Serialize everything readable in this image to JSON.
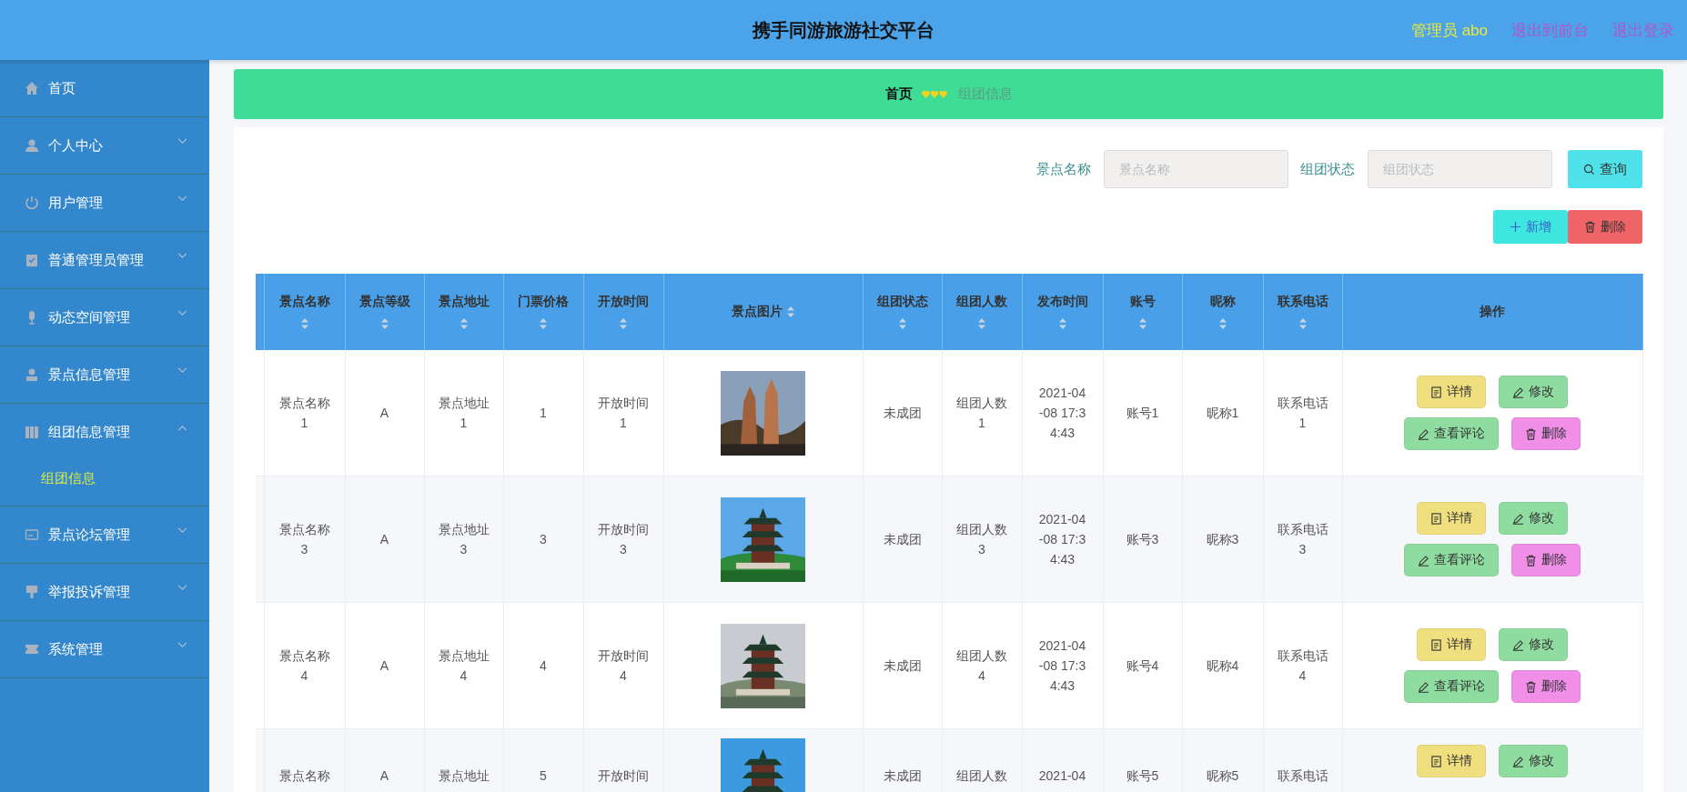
{
  "header": {
    "title": "携手同游旅游社交平台",
    "user": "管理员 abo",
    "links": [
      "退出到前台",
      "退出登录"
    ]
  },
  "sidebar": {
    "items": [
      {
        "label": "首页"
      },
      {
        "label": "个人中心",
        "expanded": false
      },
      {
        "label": "用户管理",
        "expanded": false
      },
      {
        "label": "普通管理员管理",
        "expanded": false
      },
      {
        "label": "动态空间管理",
        "expanded": false
      },
      {
        "label": "景点信息管理",
        "expanded": false
      },
      {
        "label": "组团信息管理",
        "expanded": true,
        "children": [
          {
            "label": "组团信息",
            "selected": true
          }
        ]
      },
      {
        "label": "景点论坛管理",
        "expanded": false
      },
      {
        "label": "举报投诉管理",
        "expanded": false
      },
      {
        "label": "系统管理",
        "expanded": false
      }
    ]
  },
  "breadcrumb": [
    "首页",
    "组团信息"
  ],
  "search": {
    "fields": [
      {
        "label": "景点名称",
        "placeholder": "景点名称"
      },
      {
        "label": "组团状态",
        "placeholder": "组团状态"
      }
    ],
    "button": "查询"
  },
  "actions": [
    {
      "kind": "add",
      "label": "新增"
    },
    {
      "kind": "delete",
      "label": "删除"
    }
  ],
  "table": {
    "columns": [
      {
        "label": "景点名称",
        "sortable": true
      },
      {
        "label": "景点等级",
        "sortable": true
      },
      {
        "label": "景点地址",
        "sortable": true
      },
      {
        "label": "门票价格",
        "sortable": true
      },
      {
        "label": "开放时间",
        "sortable": true
      },
      {
        "label": "景点图片",
        "sortable": true
      },
      {
        "label": "组团状态",
        "sortable": true
      },
      {
        "label": "组团人数",
        "sortable": true
      },
      {
        "label": "发布时间",
        "sortable": true
      },
      {
        "label": "账号",
        "sortable": true
      },
      {
        "label": "昵称",
        "sortable": true
      },
      {
        "label": "联系电话",
        "sortable": true
      },
      {
        "label": "操作",
        "sortable": false
      }
    ],
    "rows": [
      {
        "cells": [
          "景点名称1",
          "A",
          "景点地址1",
          "1",
          "开放时间1",
          null,
          "未成团",
          "组团人数1",
          "2021-04-08 17:34:43",
          "账号1",
          "昵称1",
          "联系电话1"
        ],
        "image": {
          "kind": "picture"
        },
        "buttons": [
          {
            "kind": "detail",
            "label": "详情"
          },
          {
            "kind": "edit",
            "label": "修改"
          },
          {
            "kind": "review",
            "label": "查看评论"
          },
          {
            "kind": "delete",
            "label": "删除"
          }
        ]
      },
      {
        "cells": [
          "景点名称3",
          "A",
          "景点地址3",
          "3",
          "开放时间3",
          null,
          "未成团",
          "组团人数3",
          "2021-04-08 17:34:43",
          "账号3",
          "昵称3",
          "联系电话3"
        ],
        "image": {
          "kind": "picture"
        },
        "buttons": [
          {
            "kind": "detail",
            "label": "详情"
          },
          {
            "kind": "edit",
            "label": "修改"
          },
          {
            "kind": "review",
            "label": "查看评论"
          },
          {
            "kind": "delete",
            "label": "删除"
          }
        ]
      },
      {
        "cells": [
          "景点名称4",
          "A",
          "景点地址4",
          "4",
          "开放时间4",
          null,
          "未成团",
          "组团人数4",
          "2021-04-08 17:34:43",
          "账号4",
          "昵称4",
          "联系电话4"
        ],
        "image": {
          "kind": "picture"
        },
        "buttons": [
          {
            "kind": "detail",
            "label": "详情"
          },
          {
            "kind": "edit",
            "label": "修改"
          },
          {
            "kind": "review",
            "label": "查看评论"
          },
          {
            "kind": "delete",
            "label": "删除"
          }
        ]
      },
      {
        "cells": [
          "景点名称",
          "A",
          "景点地址",
          "5",
          "开放时间",
          null,
          "未成团",
          "组团人数",
          "2021-04",
          "账号5",
          "昵称5",
          "联系电话"
        ],
        "image": {
          "kind": "picture"
        },
        "buttons": [
          {
            "kind": "detail",
            "label": "详情"
          },
          {
            "kind": "edit",
            "label": "修改"
          }
        ]
      }
    ]
  }
}
